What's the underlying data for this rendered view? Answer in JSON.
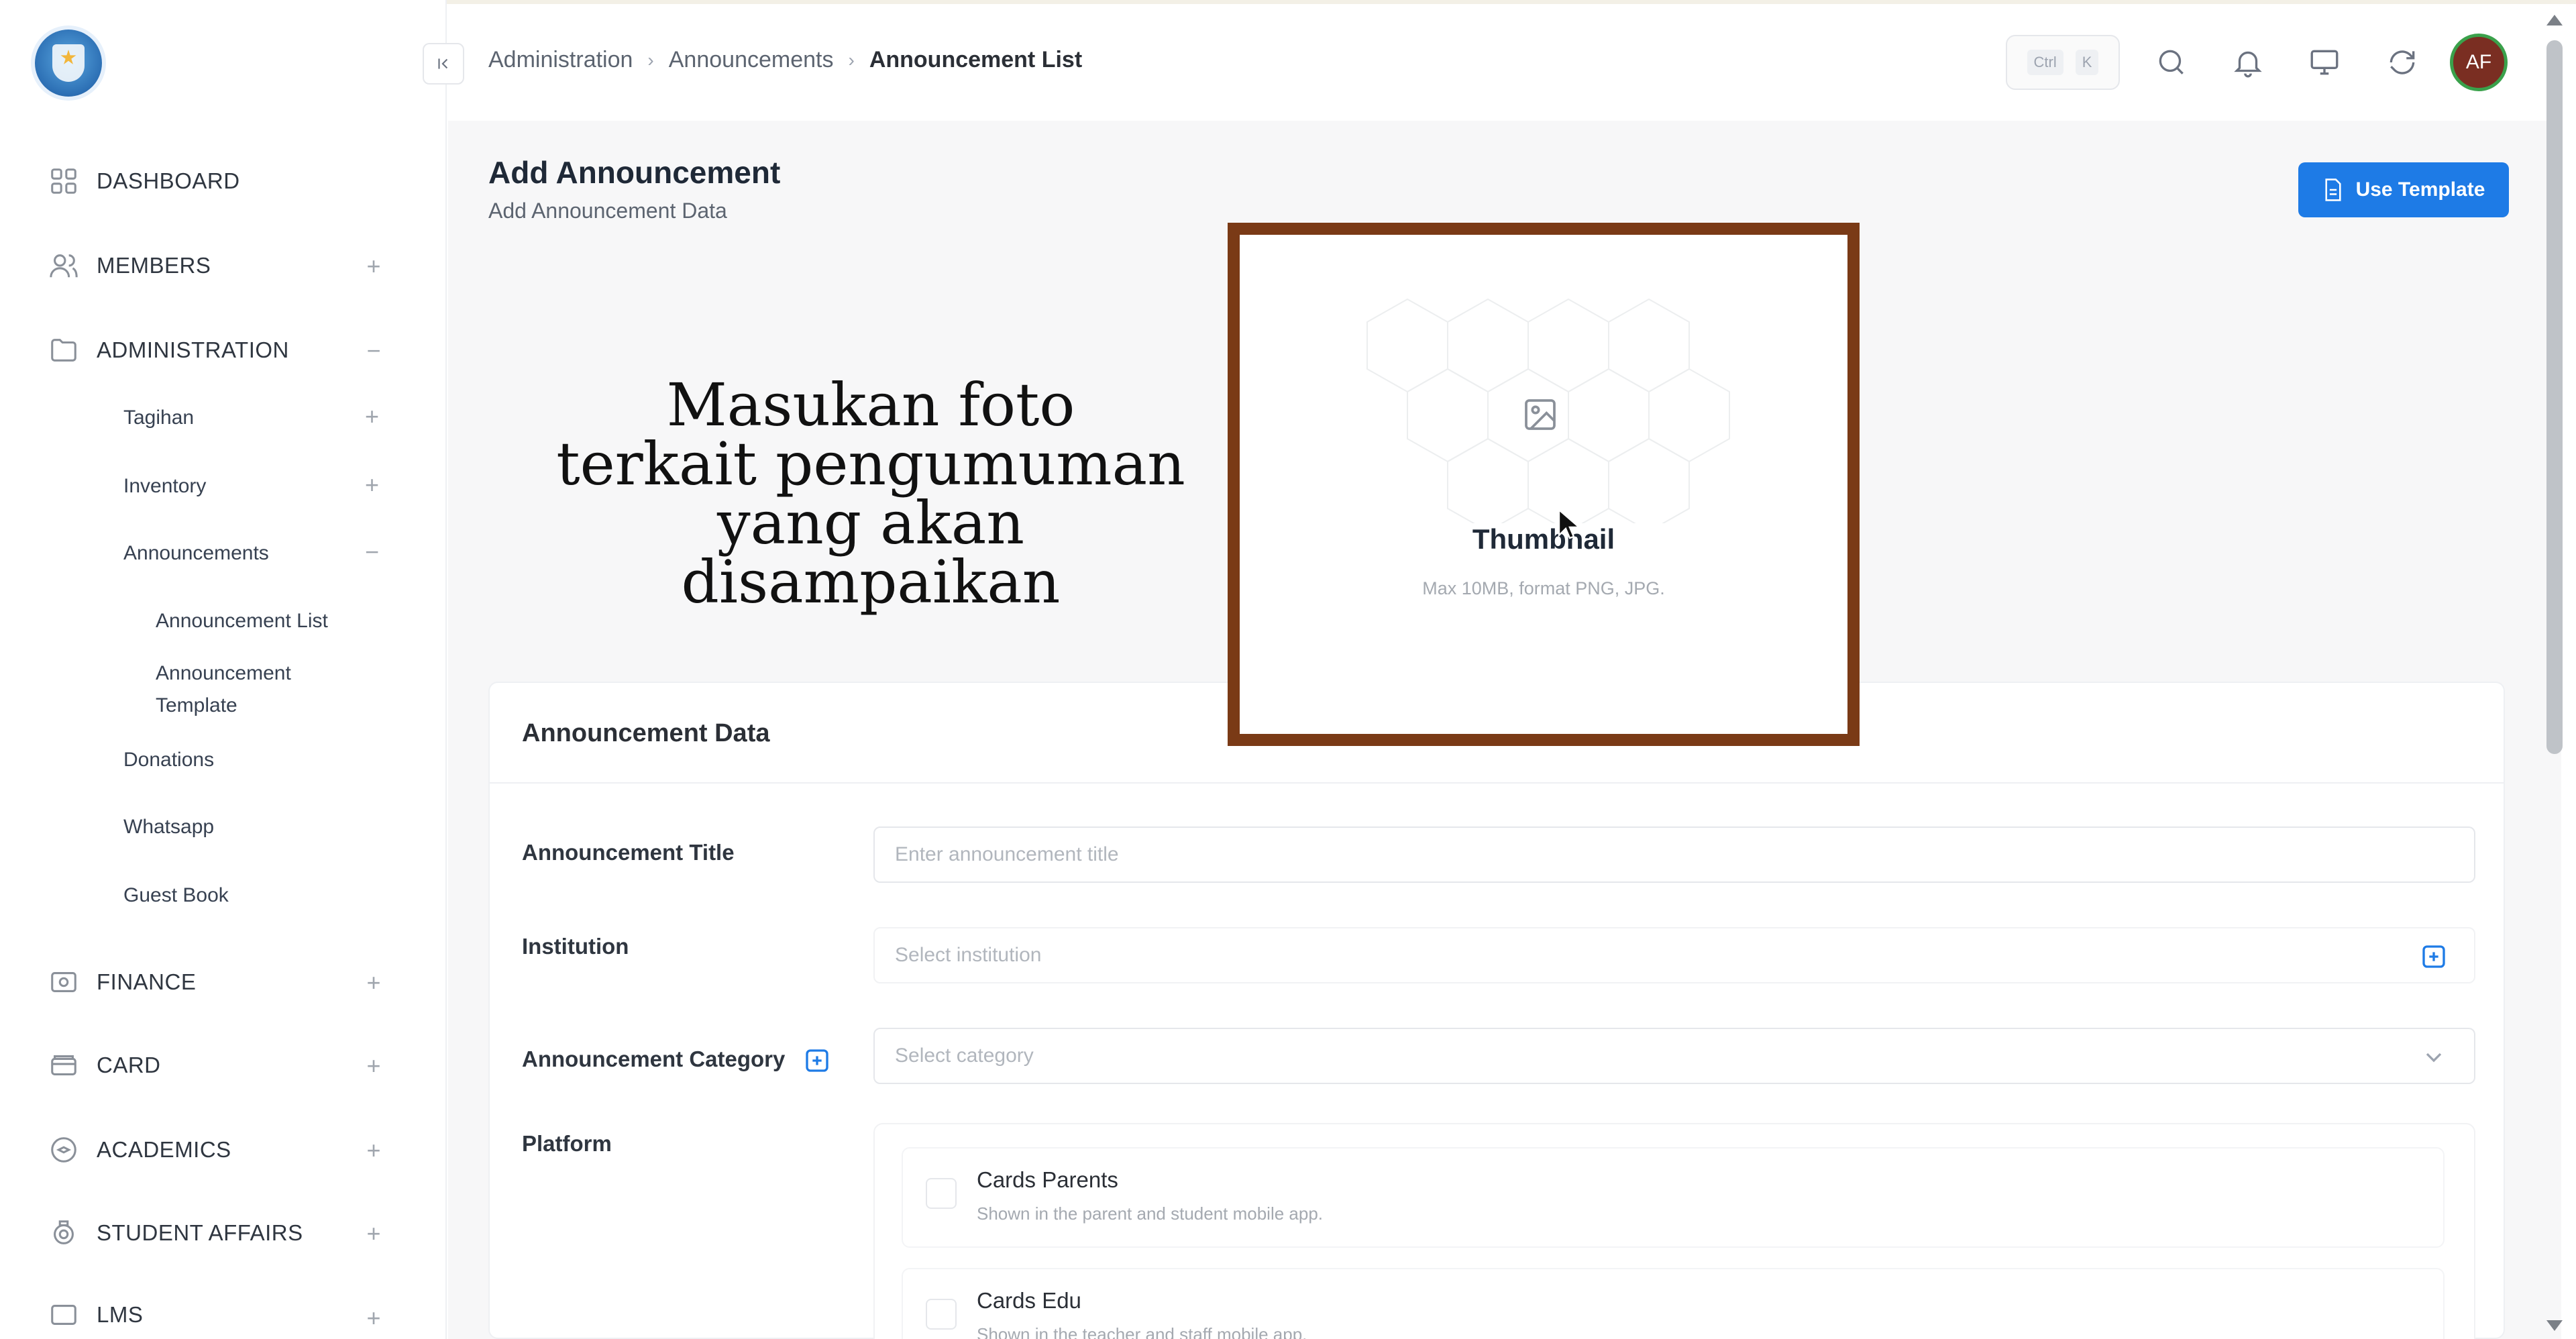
{
  "colors": {
    "accent": "#1e7be6",
    "frame": "#7a3a16",
    "avatar_bg": "#7a2e22",
    "avatar_ring": "#3aa14b"
  },
  "sidebar": {
    "logo_icon": "tut-wuri-handayani-logo",
    "items": [
      {
        "label": "DASHBOARD",
        "icon": "dashboard-grid-icon"
      },
      {
        "label": "MEMBERS",
        "icon": "users-icon",
        "toggle": "+"
      },
      {
        "label": "ADMINISTRATION",
        "icon": "folder-icon",
        "toggle": "−"
      },
      {
        "label": "FINANCE",
        "icon": "wallet-icon",
        "toggle": "+"
      },
      {
        "label": "CARD",
        "icon": "card-icon",
        "toggle": "+"
      },
      {
        "label": "ACADEMICS",
        "icon": "graduation-icon",
        "toggle": "+"
      },
      {
        "label": "STUDENT AFFAIRS",
        "icon": "badge-icon",
        "toggle": "+"
      },
      {
        "label": "LMS",
        "icon": "lms-icon",
        "toggle": "+"
      }
    ],
    "admin_sub": [
      {
        "label": "Tagihan",
        "toggle": "+"
      },
      {
        "label": "Inventory",
        "toggle": "+"
      },
      {
        "label": "Announcements",
        "toggle": "−"
      },
      {
        "label": "Donations"
      },
      {
        "label": "Whatsapp"
      },
      {
        "label": "Guest Book"
      }
    ],
    "announcement_sub": [
      {
        "label": "Announcement List"
      },
      {
        "label": "Announcement Template"
      }
    ]
  },
  "topbar": {
    "breadcrumb": [
      "Administration",
      "Announcements",
      "Announcement List"
    ],
    "shortcut": [
      "Ctrl",
      "K"
    ],
    "icons": [
      "search-icon",
      "bell-icon",
      "monitor-icon",
      "refresh-icon"
    ],
    "avatar_initials": "AF"
  },
  "page": {
    "title": "Add Announcement",
    "subtitle": "Add Announcement Data",
    "use_template_label": "Use Template"
  },
  "overlay": {
    "line1": "Masukan foto",
    "line2": "terkait pengumuman",
    "line3": "yang akan disampaikan"
  },
  "thumbnail": {
    "title": "Thumbnail",
    "hint": "Max 10MB, format PNG, JPG."
  },
  "form": {
    "section_title": "Announcement Data",
    "title_label": "Announcement Title",
    "title_placeholder": "Enter announcement title",
    "institution_label": "Institution",
    "institution_placeholder": "Select institution",
    "category_label": "Announcement Category",
    "category_placeholder": "Select category",
    "platform_label": "Platform",
    "platforms": [
      {
        "title": "Cards Parents",
        "desc": "Shown in the parent and student mobile app."
      },
      {
        "title": "Cards Edu",
        "desc": "Shown in the teacher and staff mobile app."
      }
    ]
  }
}
